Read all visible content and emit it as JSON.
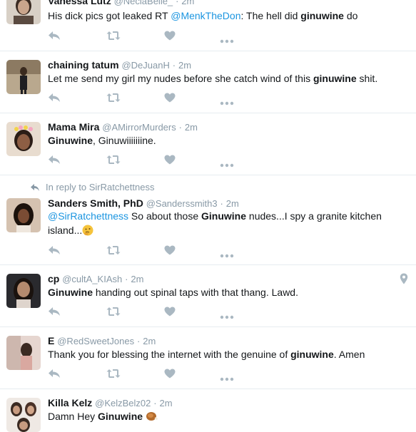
{
  "tweets": [
    {
      "fullname": "Vanessa Lutz",
      "username": "@NeciaBelle_",
      "time": "2m",
      "text_parts": [
        "His dick pics got leaked RT ",
        "@MenkTheDon",
        ": The hell did ",
        "ginuwine",
        " do"
      ]
    },
    {
      "fullname": "chaining tatum",
      "username": "@DeJuanH",
      "time": "2m",
      "text_parts": [
        "Let me send my girl my nudes before she catch wind of this ",
        "ginuwine",
        " shit."
      ]
    },
    {
      "fullname": "Mama Mira",
      "username": "@AMirrorMurders",
      "time": "2m",
      "text_parts": [
        "Ginuwine",
        ", Ginuwiiiiiiine."
      ]
    },
    {
      "reply_context": "In reply to SirRatchettness",
      "fullname": "Sanders Smith, PhD",
      "username": "@Sanderssmith3",
      "time": "2m",
      "text_parts": [
        "@SirRatchettness",
        " So about those ",
        "Ginuwine",
        " nudes...I spy a granite kitchen island..."
      ],
      "emoji": "thinking-face"
    },
    {
      "fullname": "cp",
      "username": "@cultA_KIAsh",
      "time": "2m",
      "text_parts": [
        "Ginuwine",
        " handing out spinal taps with that thang. Lawd."
      ],
      "geo": "location-pin-icon"
    },
    {
      "fullname": "E",
      "username": "@RedSweetJones",
      "time": "2m",
      "text_parts": [
        "Thank you for blessing the internet with the genuine of ",
        "ginuwine",
        ". Amen"
      ]
    },
    {
      "fullname": "Killa Kelz",
      "username": "@KelzBelz02",
      "time": "2m",
      "text_parts": [
        "Damn Hey ",
        "Ginuwine"
      ],
      "emoji": "turkey-leg"
    }
  ],
  "separator": "·",
  "icons": {
    "reply": "reply-icon",
    "retweet": "retweet-icon",
    "like": "heart-icon",
    "more": "more-dots-icon",
    "reply_context": "reply-arrow-icon"
  },
  "colors": {
    "muted": "#8899a6",
    "link": "#1b95e0",
    "icon": "#aab8c2",
    "divider": "#e6ecf0",
    "text": "#14171a"
  }
}
